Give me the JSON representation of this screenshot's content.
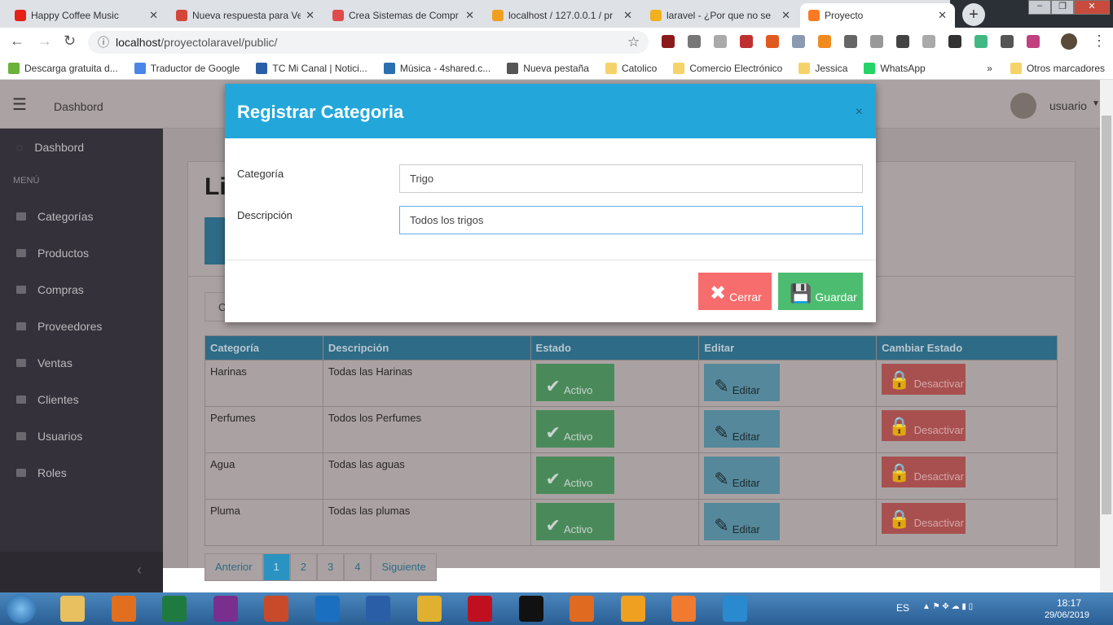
{
  "browser": {
    "tabs": [
      {
        "title": "Happy Coffee Music",
        "icon": "youtube-icon",
        "color": "#e62117"
      },
      {
        "title": "Nueva respuesta para Ve",
        "icon": "gmail-icon",
        "color": "#d44638"
      },
      {
        "title": "Crea Sistemas de Compr",
        "icon": "udemy-icon",
        "color": "#e04c4c"
      },
      {
        "title": "localhost / 127.0.0.1 / pr",
        "icon": "phpmyadmin-icon",
        "color": "#f0a020"
      },
      {
        "title": "laravel - ¿Por que no se",
        "icon": "stackoverflow-icon",
        "color": "#f2b01e"
      },
      {
        "title": "Proyecto",
        "icon": "xampp-icon",
        "color": "#fb7a24"
      }
    ],
    "url_host": "localhost",
    "url_path": "/proyectolaravel/public/",
    "bookmarks": [
      "Descarga gratuita d...",
      "Traductor de Google",
      "TC Mi Canal | Notici...",
      "Música - 4shared.c...",
      "Nueva pestaña",
      "Catolico",
      "Comercio Electrónico",
      "Jessica",
      "WhatsApp"
    ],
    "bookmarks_more": "»",
    "other_bookmarks": "Otros marcadores"
  },
  "app": {
    "header": {
      "title": "Dashbord",
      "user": "usuario"
    },
    "sidebar": {
      "dashboard": "Dashbord",
      "section": "MENÚ",
      "items": [
        "Categorías",
        "Productos",
        "Compras",
        "Proveedores",
        "Ventas",
        "Clientes",
        "Usuarios",
        "Roles"
      ]
    },
    "page_title_partial": "Li",
    "search_partial": "C",
    "table": {
      "headers": [
        "Categoría",
        "Descripción",
        "Estado",
        "Editar",
        "Cambiar Estado"
      ],
      "rows": [
        {
          "categoria": "Harinas",
          "descripcion": "Todas las Harinas"
        },
        {
          "categoria": "Perfumes",
          "descripcion": "Todos los Perfumes"
        },
        {
          "categoria": "Agua",
          "descripcion": "Todas las aguas"
        },
        {
          "categoria": "Pluma",
          "descripcion": "Todas las plumas"
        }
      ],
      "estado_label": "Activo",
      "editar_label": "Editar",
      "desactivar_label": "Desactivar"
    },
    "pagination": {
      "prev": "Anterior",
      "pages": [
        "1",
        "2",
        "3",
        "4"
      ],
      "active": "1",
      "next": "Siguiente"
    }
  },
  "modal": {
    "title": "Registrar Categoria",
    "close_symbol": "×",
    "fields": [
      {
        "label": "Categoría",
        "value": "Trigo"
      },
      {
        "label": "Descripción",
        "value": "Todos los trigos"
      }
    ],
    "cancel": "Cerrar",
    "save": "Guardar",
    "colors": {
      "header": "#23a7db",
      "cancel": "#f76c6c",
      "save": "#4cbd70"
    }
  },
  "taskbar": {
    "lang": "ES",
    "time": "18:17",
    "date": "29/06/2019"
  }
}
